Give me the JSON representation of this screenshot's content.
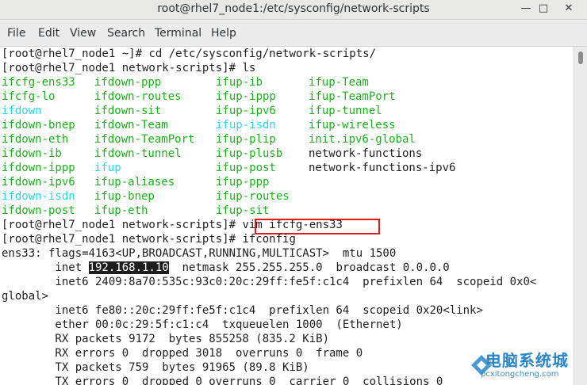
{
  "window": {
    "title": "root@rhel7_node1:/etc/sysconfig/network-scripts",
    "minimize_icon": "minimize-icon",
    "maximize_icon": "maximize-icon",
    "close_icon": "close-icon"
  },
  "menu": [
    "File",
    "Edit",
    "View",
    "Search",
    "Terminal",
    "Help"
  ],
  "colors": {
    "terminal_bg": "#ffffff",
    "text": "#1e1e1e",
    "green": "#19b319",
    "cyan": "#27d8e6",
    "highlight_box": "#e11b1b"
  },
  "terminal": {
    "prompt": "[root@rhel7_node1 ~]# ",
    "prompt_ns": "[root@rhel7_node1 network-scripts]# ",
    "cmd_cd": "cd /etc/sysconfig/network-scripts/",
    "cmd_ls": "ls",
    "cmd_vim": "vim ifcfg-ens33",
    "cmd_ifconfig": "ifconfig",
    "ls_rows": [
      [
        "ifcfg-ens33",
        "ifdown-ppp",
        "ifup-ib",
        "ifup-Team"
      ],
      [
        "ifcfg-lo",
        "ifdown-routes",
        "ifup-ippp",
        "ifup-TeamPort"
      ],
      [
        "ifdown",
        "ifdown-sit",
        "ifup-ipv6",
        "ifup-tunnel"
      ],
      [
        "ifdown-bnep",
        "ifdown-Team",
        "ifup-isdn",
        "ifup-wireless"
      ],
      [
        "ifdown-eth",
        "ifdown-TeamPort",
        "ifup-plip",
        "init.ipv6-global"
      ],
      [
        "ifdown-ib",
        "ifdown-tunnel",
        "ifup-plusb",
        "network-functions"
      ],
      [
        "ifdown-ippp",
        "ifup",
        "ifup-post",
        "network-functions-ipv6"
      ],
      [
        "ifdown-ipv6",
        "ifup-aliases",
        "ifup-ppp",
        ""
      ],
      [
        "ifdown-isdn",
        "ifup-bnep",
        "ifup-routes",
        ""
      ],
      [
        "ifdown-post",
        "ifup-eth",
        "ifup-sit",
        ""
      ]
    ],
    "ifconfig": {
      "l1": "ens33: flags=4163<UP,BROADCAST,RUNNING,MULTICAST>  mtu 1500",
      "inet_prefix": "        inet ",
      "ip": "192.168.1.10",
      "inet_rest": "  netmask 255.255.255.0  broadcast 0.0.0.0",
      "l3": "        inet6 2409:8a70:535c:93c0:20c:29ff:fe5f:c1c4  prefixlen 64  scopeid 0x0<",
      "l4": "global>",
      "l5": "        inet6 fe80::20c:29ff:fe5f:c1c4  prefixlen 64  scopeid 0x20<link>",
      "l6": "        ether 00:0c:29:5f:c1:c4  txqueuelen 1000  (Ethernet)",
      "l7": "        RX packets 9172  bytes 855258 (835.2 KiB)",
      "l8": "        RX errors 0  dropped 3018  overruns 0  frame 0",
      "l9": "        TX packets 759  bytes 91965 (89.8 KiB)",
      "l10": "        TX errors 0  dropped 0 overruns 0  carrier 0  collisions 0"
    }
  },
  "watermark": {
    "cn": "电脑系统城",
    "en": "pcxitongcheng.com"
  }
}
